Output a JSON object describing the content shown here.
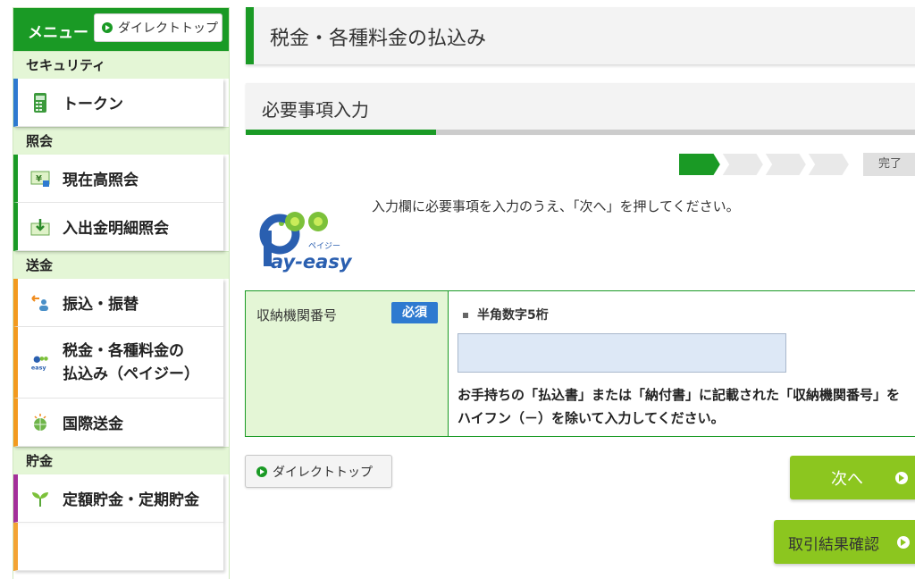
{
  "sidebar": {
    "menu_title": "メニュー",
    "direct_top": "ダイレクトトップ",
    "sections": [
      {
        "title": "セキュリティ",
        "items": [
          {
            "label": "トークン",
            "icon": "token-icon"
          }
        ]
      },
      {
        "title": "照会",
        "items": [
          {
            "label": "現在高照会",
            "icon": "balance-icon"
          },
          {
            "label": "入出金明細照会",
            "icon": "statement-icon"
          }
        ]
      },
      {
        "title": "送金",
        "items": [
          {
            "label": "振込・振替",
            "icon": "transfer-icon"
          },
          {
            "label": "税金・各種料金の\n払込み（ペイジー）",
            "icon": "payeasy-icon"
          },
          {
            "label": "国際送金",
            "icon": "globe-icon"
          }
        ]
      },
      {
        "title": "貯金",
        "items": [
          {
            "label": "定額貯金・定期貯金",
            "icon": "sprout-icon"
          }
        ]
      }
    ]
  },
  "header": {
    "title": "税金・各種料金の払込み"
  },
  "step": {
    "title": "必要事項入力",
    "progress": 0.28,
    "complete_label": "完了",
    "current_step": 1,
    "total_steps": 5
  },
  "instruction": "入力欄に必要事項を入力のうえ、「次へ」を押してください。",
  "logo": {
    "kana": "ペイジー",
    "text": "ay-easy"
  },
  "form": {
    "label": "収納機関番号",
    "required": "必須",
    "hint": "半角数字5桁",
    "value": "",
    "note": "お手持ちの「払込書」または「納付書」に記載された「収納機関番号」をハイフン（－）を除いて入力してください。"
  },
  "buttons": {
    "direct_top": "ダイレクトトップ",
    "next": "次へ",
    "result": "取引結果確認"
  },
  "colors": {
    "brand_green": "#1a9a25",
    "light_green": "#e4f6d6",
    "accent_green": "#8cc61f",
    "required_blue": "#2e7ad0"
  }
}
